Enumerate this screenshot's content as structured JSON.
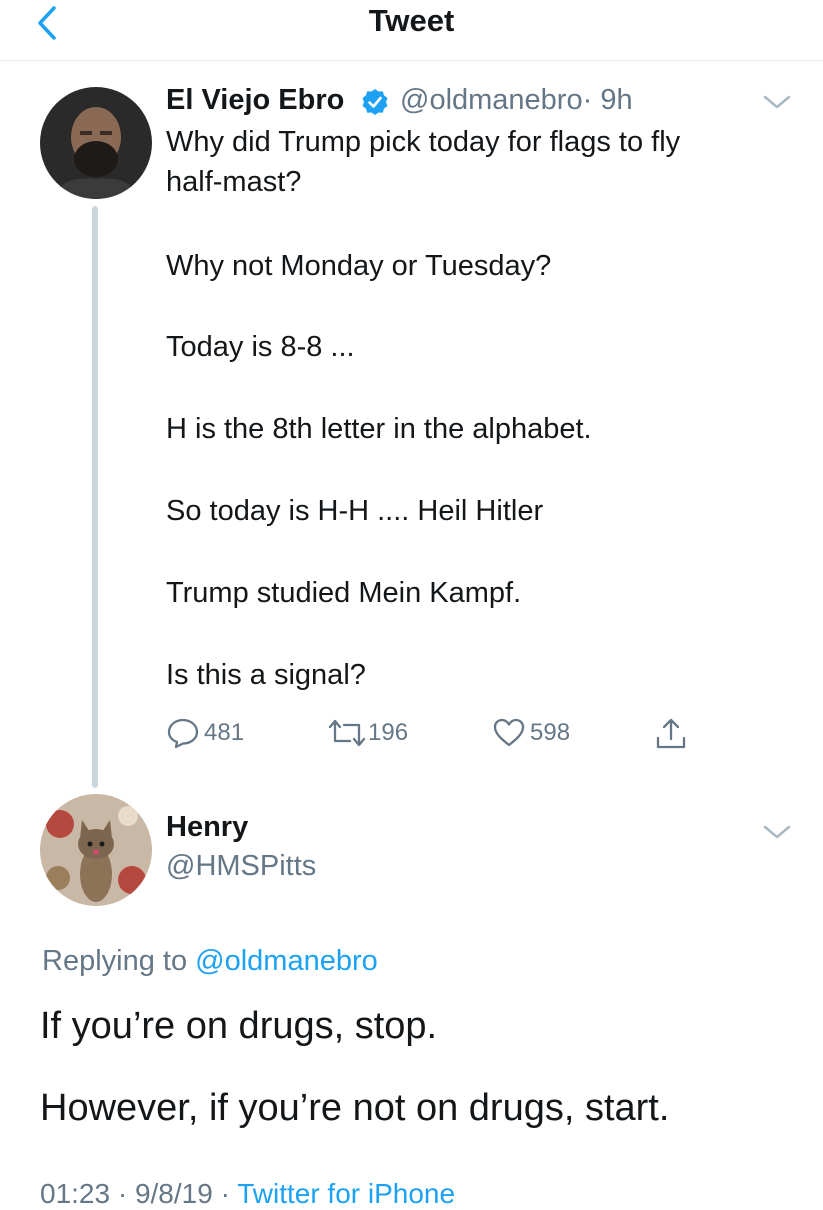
{
  "nav": {
    "title": "Tweet"
  },
  "tweet": {
    "author_name": "El Viejo Ebro",
    "author_handle": "@oldmanebro",
    "time": "· 9h",
    "lines": [
      "Why did Trump pick today for flags to fly",
      "half-mast?",
      "Why not Monday or Tuesday?",
      "Today is 8-8 ...",
      "H is the 8th letter in the alphabet.",
      "So today is H-H .... Heil Hitler",
      "Trump studied Mein Kampf.",
      "Is this a signal?"
    ],
    "stats": {
      "replies": "481",
      "retweets": "196",
      "likes": "598"
    }
  },
  "reply": {
    "author_name": "Henry",
    "author_handle": "@HMSPitts",
    "replying_prefix": "Replying to",
    "replying_to": "@oldmanebro",
    "lines": [
      "If you’re on drugs, stop.",
      "However, if you’re not on drugs, start."
    ],
    "meta_time": "01:23 · 9/8/19 ·",
    "meta_source": "Twitter for iPhone"
  },
  "colors": {
    "accent": "#1da1f2",
    "secondary_text": "#657786",
    "primary_text": "#14171a",
    "divider": "#e6ecf0"
  },
  "icons": [
    "back-chevron-icon",
    "verified-badge-icon",
    "caret-down-icon",
    "reply-icon",
    "retweet-icon",
    "like-icon",
    "share-icon"
  ]
}
